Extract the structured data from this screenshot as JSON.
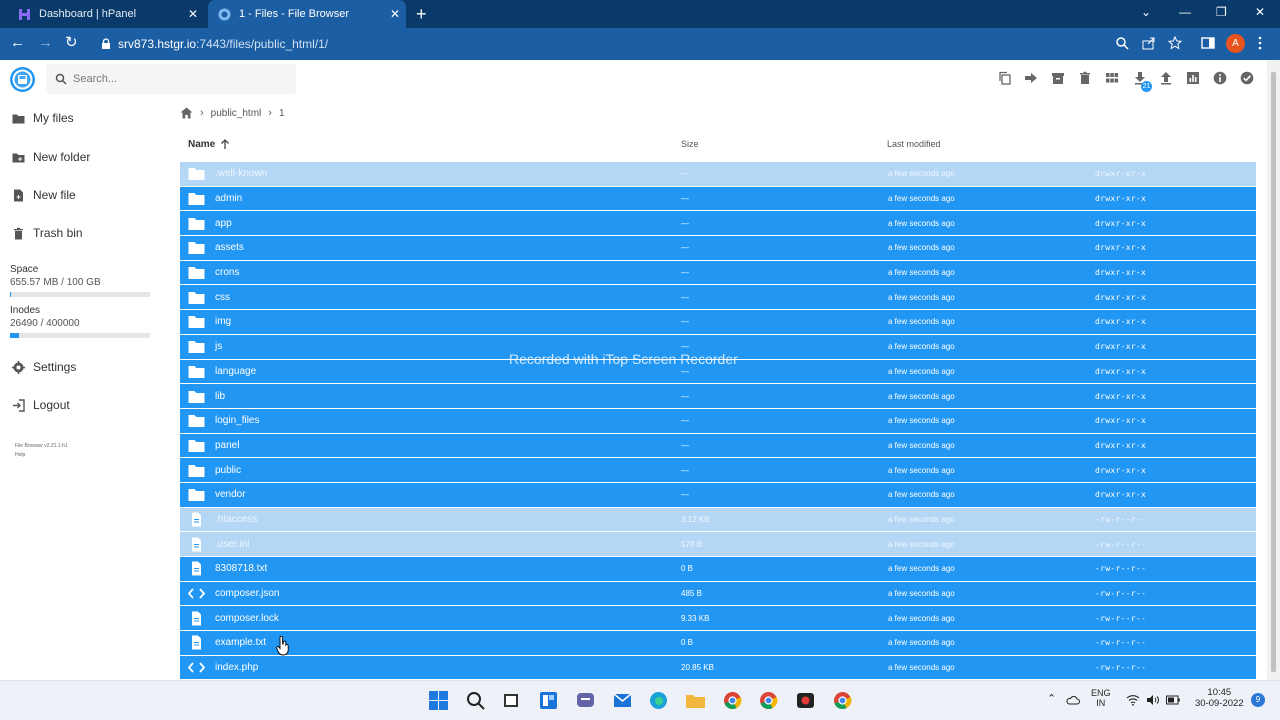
{
  "browser": {
    "tabs": [
      {
        "title": "Dashboard | hPanel"
      },
      {
        "title": "1 - Files - File Browser"
      }
    ],
    "url_host": "srv873.hstgr.io",
    "url_path": ":7443/files/public_html/1/",
    "profile_initial": "A"
  },
  "app": {
    "search_placeholder": "Search...",
    "download_badge": "21"
  },
  "sidebar": {
    "items": [
      {
        "label": "My files"
      },
      {
        "label": "New folder"
      },
      {
        "label": "New file"
      },
      {
        "label": "Trash bin"
      }
    ],
    "space_label": "Space",
    "space_value": "655.57 MB / 100 GB",
    "space_used_fraction": 0.0064,
    "inodes_label": "Inodes",
    "inodes_value": "26490 / 400000",
    "inodes_used_fraction": 0.066,
    "settings_label": "Settings",
    "logout_label": "Logout",
    "version": "File Browser v2.21.1-h1",
    "help": "Help"
  },
  "breadcrumbs": [
    "public_html",
    "1"
  ],
  "columns": {
    "name": "Name",
    "size": "Size",
    "modified": "Last modified"
  },
  "files": [
    {
      "name": ".well-known",
      "type": "folder",
      "size": "—",
      "modified": "a few seconds ago",
      "perms": "drwxr-xr-x",
      "selected": false
    },
    {
      "name": "admin",
      "type": "folder",
      "size": "—",
      "modified": "a few seconds ago",
      "perms": "drwxr-xr-x",
      "selected": true
    },
    {
      "name": "app",
      "type": "folder",
      "size": "—",
      "modified": "a few seconds ago",
      "perms": "drwxr-xr-x",
      "selected": true
    },
    {
      "name": "assets",
      "type": "folder",
      "size": "—",
      "modified": "a few seconds ago",
      "perms": "drwxr-xr-x",
      "selected": true
    },
    {
      "name": "crons",
      "type": "folder",
      "size": "—",
      "modified": "a few seconds ago",
      "perms": "drwxr-xr-x",
      "selected": true
    },
    {
      "name": "css",
      "type": "folder",
      "size": "—",
      "modified": "a few seconds ago",
      "perms": "drwxr-xr-x",
      "selected": true
    },
    {
      "name": "img",
      "type": "folder",
      "size": "—",
      "modified": "a few seconds ago",
      "perms": "drwxr-xr-x",
      "selected": true
    },
    {
      "name": "js",
      "type": "folder",
      "size": "—",
      "modified": "a few seconds ago",
      "perms": "drwxr-xr-x",
      "selected": true
    },
    {
      "name": "language",
      "type": "folder",
      "size": "—",
      "modified": "a few seconds ago",
      "perms": "drwxr-xr-x",
      "selected": true
    },
    {
      "name": "lib",
      "type": "folder",
      "size": "—",
      "modified": "a few seconds ago",
      "perms": "drwxr-xr-x",
      "selected": true
    },
    {
      "name": "login_files",
      "type": "folder",
      "size": "—",
      "modified": "a few seconds ago",
      "perms": "drwxr-xr-x",
      "selected": true
    },
    {
      "name": "panel",
      "type": "folder",
      "size": "—",
      "modified": "a few seconds ago",
      "perms": "drwxr-xr-x",
      "selected": true
    },
    {
      "name": "public",
      "type": "folder",
      "size": "—",
      "modified": "a few seconds ago",
      "perms": "drwxr-xr-x",
      "selected": true
    },
    {
      "name": "vendor",
      "type": "folder",
      "size": "—",
      "modified": "a few seconds ago",
      "perms": "drwxr-xr-x",
      "selected": true
    },
    {
      "name": ".htaccess",
      "type": "file",
      "size": "3.12 KB",
      "modified": "a few seconds ago",
      "perms": "-rw-r--r--",
      "selected": false
    },
    {
      "name": ".user.ini",
      "type": "file",
      "size": "578 B",
      "modified": "a few seconds ago",
      "perms": "-rw-r--r--",
      "selected": false
    },
    {
      "name": "8308718.txt",
      "type": "file",
      "size": "0 B",
      "modified": "a few seconds ago",
      "perms": "-rw-r--r--",
      "selected": true
    },
    {
      "name": "composer.json",
      "type": "code",
      "size": "485 B",
      "modified": "a few seconds ago",
      "perms": "-rw-r--r--",
      "selected": true
    },
    {
      "name": "composer.lock",
      "type": "file",
      "size": "9.33 KB",
      "modified": "a few seconds ago",
      "perms": "-rw-r--r--",
      "selected": true
    },
    {
      "name": "example.txt",
      "type": "file",
      "size": "0 B",
      "modified": "a few seconds ago",
      "perms": "-rw-r--r--",
      "selected": true
    },
    {
      "name": "index.php",
      "type": "code",
      "size": "20.85 KB",
      "modified": "a few seconds ago",
      "perms": "-rw-r--r--",
      "selected": true
    }
  ],
  "watermark": "Recorded with iTop Screen Recorder",
  "taskbar": {
    "lang_1": "ENG",
    "lang_2": "IN",
    "time": "10:45",
    "date": "30-09-2022",
    "notifications": "9"
  }
}
